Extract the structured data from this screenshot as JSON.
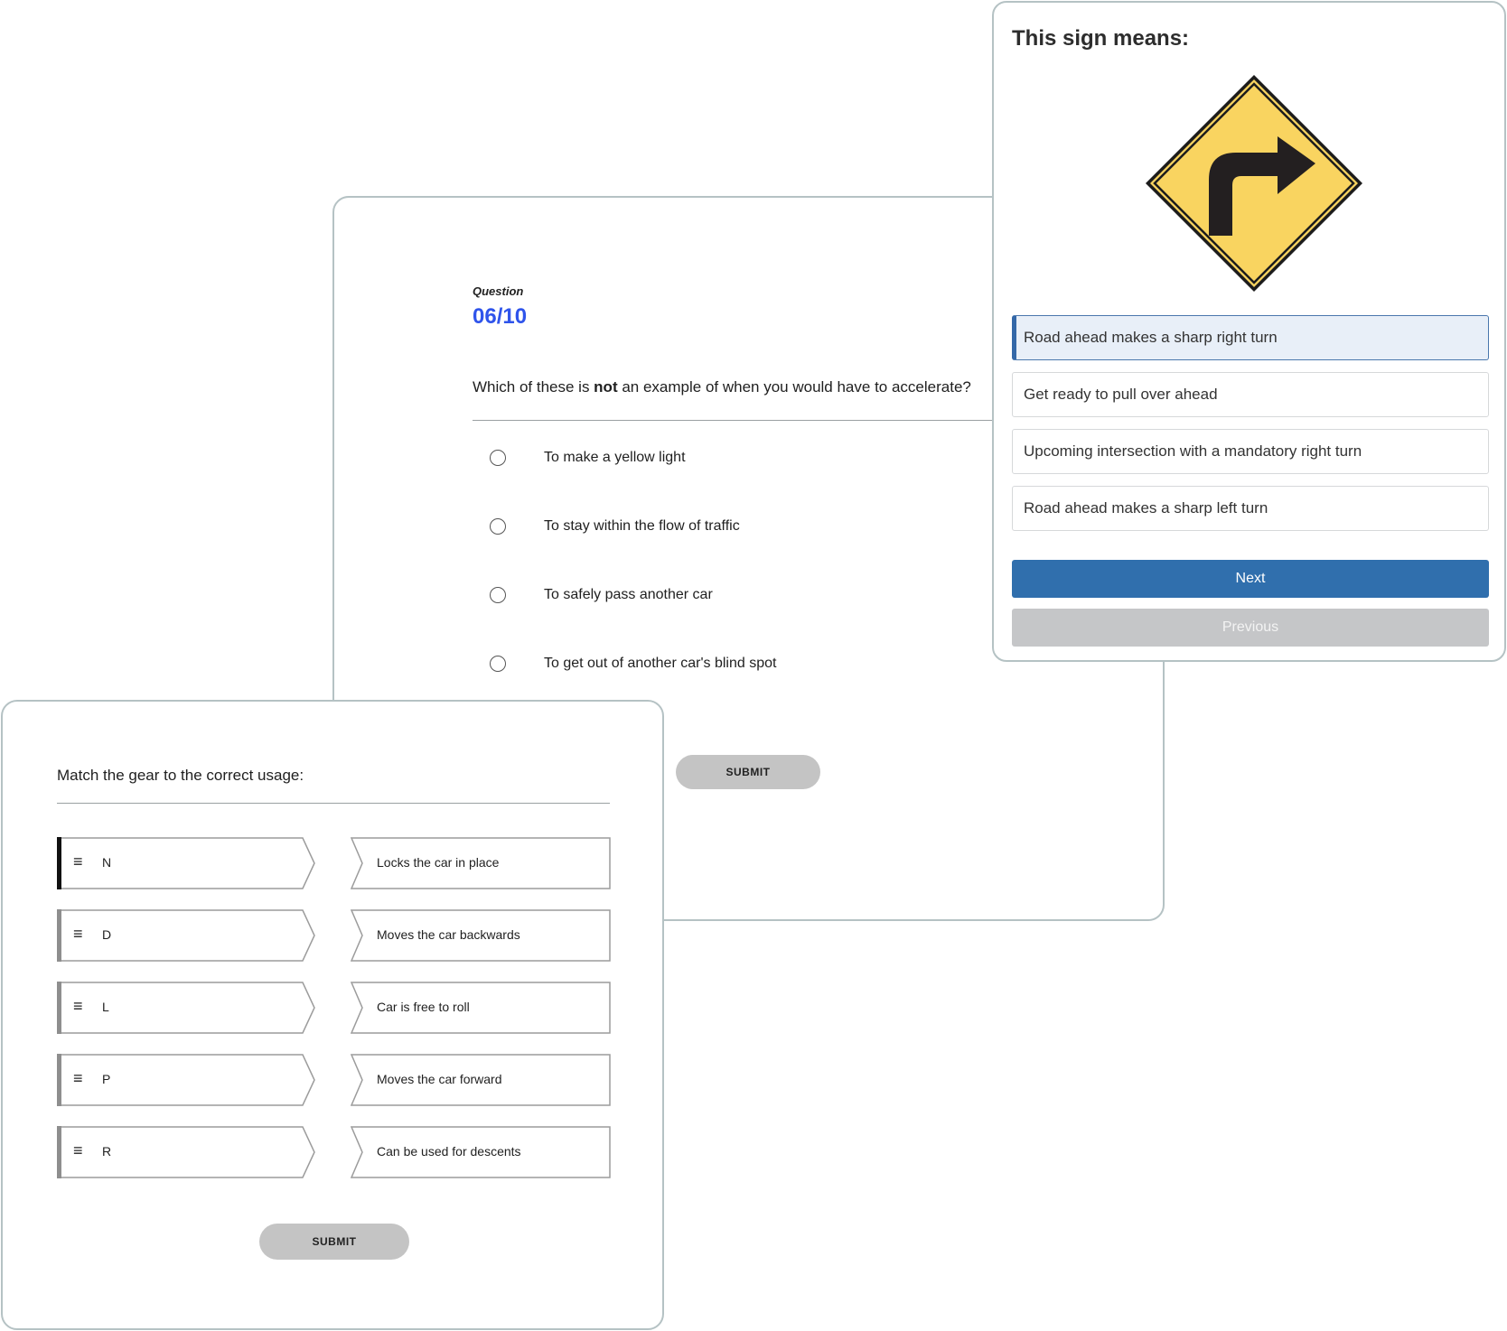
{
  "mc_card": {
    "question_label": "Question",
    "question_count": "06/10",
    "question_pre": "Which of these is ",
    "question_bold": "not",
    "question_post": " an example of when you would have to accelerate?",
    "options": [
      {
        "label": "To make a yellow light"
      },
      {
        "label": "To stay within the flow of traffic"
      },
      {
        "label": "To safely pass another car"
      },
      {
        "label": "To get out of another car's blind spot"
      }
    ],
    "submit_label": "SUBMIT"
  },
  "sign_card": {
    "title": "This sign means:",
    "sign_icon": "sharp-right-turn-sign-icon",
    "sign_color": "#f9d460",
    "options": [
      {
        "label": "Road ahead makes a sharp right turn",
        "selected": true
      },
      {
        "label": "Get ready to pull over ahead",
        "selected": false
      },
      {
        "label": "Upcoming intersection with a mandatory right turn",
        "selected": false
      },
      {
        "label": "Road ahead makes a sharp left turn",
        "selected": false
      }
    ],
    "next_label": "Next",
    "previous_label": "Previous",
    "accent_color": "#306fad"
  },
  "match_card": {
    "prompt": "Match the gear to the correct usage:",
    "gears": [
      {
        "label": "N",
        "active": true
      },
      {
        "label": "D",
        "active": false
      },
      {
        "label": "L",
        "active": false
      },
      {
        "label": "P",
        "active": false
      },
      {
        "label": "R",
        "active": false
      }
    ],
    "usages": [
      {
        "label": "Locks the car in place"
      },
      {
        "label": "Moves the car backwards"
      },
      {
        "label": "Car is free to roll"
      },
      {
        "label": "Moves the car forward"
      },
      {
        "label": "Can be used for descents"
      }
    ],
    "handle_icon": "drag-handle-icon",
    "submit_label": "SUBMIT"
  }
}
